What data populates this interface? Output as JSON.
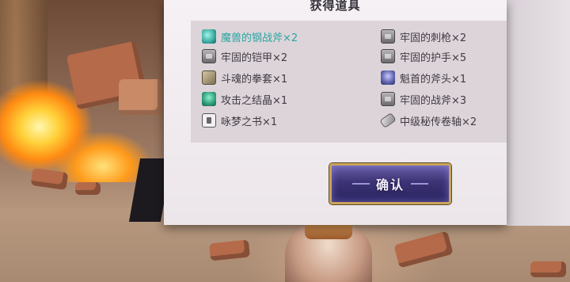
{
  "dialog": {
    "title": "获得道具",
    "confirm_label": "确认"
  },
  "items": [
    {
      "name": "魔兽的钢战斧×2",
      "icon": "gem-icon",
      "highlight": true
    },
    {
      "name": "牢固的刺枪×2",
      "icon": "armor-icon",
      "highlight": false
    },
    {
      "name": "牢固的铠甲×2",
      "icon": "armor-icon",
      "highlight": false
    },
    {
      "name": "牢固的护手×5",
      "icon": "armor-icon",
      "highlight": false
    },
    {
      "name": "斗魂的拳套×1",
      "icon": "glove-icon",
      "highlight": false
    },
    {
      "name": "魁首的斧头×1",
      "icon": "axe-icon",
      "highlight": false
    },
    {
      "name": "攻击之结晶×1",
      "icon": "crystal-icon",
      "highlight": false
    },
    {
      "name": "牢固的战斧×3",
      "icon": "armor-icon",
      "highlight": false
    },
    {
      "name": "咏梦之书×1",
      "icon": "book-icon",
      "highlight": false
    },
    {
      "name": "中级秘传卷轴×2",
      "icon": "scroll-icon",
      "highlight": false
    }
  ],
  "colors": {
    "highlight_text": "#2aa6a0",
    "normal_text": "#3f3a42",
    "button_border": "#c8a45a",
    "button_fill": "#3b3374"
  }
}
